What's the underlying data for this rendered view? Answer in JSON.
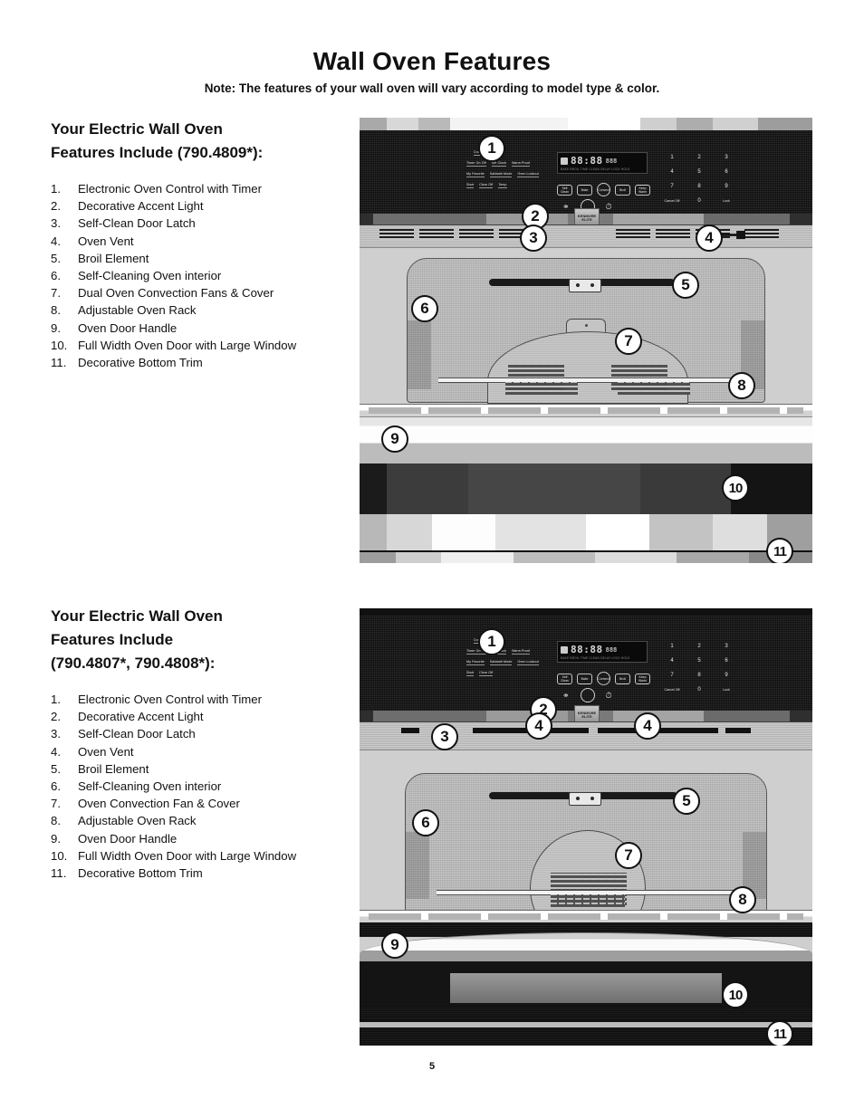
{
  "header": {
    "title": "Wall Oven Features",
    "note": "Note: The features of your wall oven will vary according to model type & color."
  },
  "sections": [
    {
      "heading_line1": "Your Electric Wall Oven",
      "heading_line2": "Features Include (790.4809*):",
      "heading_line3": "",
      "items": [
        {
          "num": "1.",
          "text": "Electronic Oven Control with Timer"
        },
        {
          "num": "2.",
          "text": "Decorative Accent Light"
        },
        {
          "num": "3.",
          "text": "Self-Clean Door Latch"
        },
        {
          "num": "4.",
          "text": "Oven Vent"
        },
        {
          "num": "5.",
          "text": "Broil Element"
        },
        {
          "num": "6.",
          "text": "Self-Cleaning Oven interior"
        },
        {
          "num": "7.",
          "text": "Dual Oven Convection Fans & Cover"
        },
        {
          "num": "8.",
          "text": "Adjustable Oven Rack"
        },
        {
          "num": "9.",
          "text": "Oven Door Handle"
        },
        {
          "num": "10.",
          "text": "Full Width Oven Door with Large Window"
        },
        {
          "num": "11.",
          "text": "Decorative Bottom Trim"
        }
      ]
    },
    {
      "heading_line1": "Your Electric Wall Oven",
      "heading_line2": "Features Include",
      "heading_line3": "(790.4807*, 790.4808*):",
      "items": [
        {
          "num": "1.",
          "text": "Electronic Oven Control with Timer"
        },
        {
          "num": "2.",
          "text": "Decorative Accent Light"
        },
        {
          "num": "3.",
          "text": "Self-Clean Door Latch"
        },
        {
          "num": "4.",
          "text": "Oven Vent"
        },
        {
          "num": "5.",
          "text": "Broil Element"
        },
        {
          "num": "6.",
          "text": "Self-Cleaning Oven interior"
        },
        {
          "num": "7.",
          "text": "Oven Convection Fan & Cover"
        },
        {
          "num": "8.",
          "text": "Adjustable Oven Rack"
        },
        {
          "num": "9.",
          "text": "Oven Door Handle"
        },
        {
          "num": "10.",
          "text": "Full Width Oven Door with Large Window"
        },
        {
          "num": "11.",
          "text": "Decorative Bottom Trim"
        }
      ]
    }
  ],
  "figures": {
    "figure1": {
      "callouts": [
        "1",
        "2",
        "3",
        "4",
        "5",
        "6",
        "7",
        "8",
        "9",
        "10",
        "11"
      ],
      "control_panel": {
        "display_digits": "88:88",
        "display_small": "888",
        "display_subtext": "BAKE BROIL TIME CLEAN DELAY LOCK HOLD",
        "soft_keys": [
          "Self Clean",
          "Bake",
          "Convect",
          "Broil",
          "Keep Warm"
        ],
        "icon_keys": [
          "light-icon",
          "dial-icon",
          "timer-icon"
        ],
        "keypad": [
          "1",
          "2",
          "3",
          "4",
          "5",
          "6",
          "7",
          "8",
          "9",
          "Cancel Off",
          "0",
          "Lock"
        ],
        "left_pad_labels": [
          [
            "Cook Time",
            "Stop"
          ],
          [
            "Timer On Off",
            "Set Clock",
            "Warm Proof"
          ],
          [
            "My Favorite",
            "Sabbath Mode",
            "Oven Lockout"
          ],
          [
            "Start",
            "Clear Off",
            "Temp"
          ]
        ],
        "brand_plate": "KENMORE ELITE"
      }
    },
    "figure2": {
      "callouts": [
        "1",
        "2",
        "3",
        "4",
        "4",
        "5",
        "6",
        "7",
        "8",
        "9",
        "10",
        "11"
      ],
      "control_panel": {
        "display_digits": "88:88",
        "display_small": "888",
        "display_subtext": "BAKE BROIL TIME CLEAN DELAY LOCK HOLD",
        "soft_keys": [
          "Self Clean",
          "Bake",
          "Convect",
          "Broil",
          "Keep Warm"
        ],
        "icon_keys": [
          "light-icon",
          "dial-icon",
          "timer-icon"
        ],
        "keypad": [
          "1",
          "2",
          "3",
          "4",
          "5",
          "6",
          "7",
          "8",
          "9",
          "Cancel Off",
          "0",
          "Lock"
        ],
        "left_pad_labels": [
          [
            "Cook Time",
            "Stop"
          ],
          [
            "Timer On Off",
            "Set Clock",
            "Warm Proof"
          ],
          [
            "My Favorite",
            "Sabbath Mode",
            "Oven Lockout"
          ],
          [
            "Start",
            "Clear Off",
            "Temp"
          ]
        ],
        "brand_plate": "KENMORE ELITE"
      }
    }
  },
  "footer": {
    "page_number": "5"
  }
}
